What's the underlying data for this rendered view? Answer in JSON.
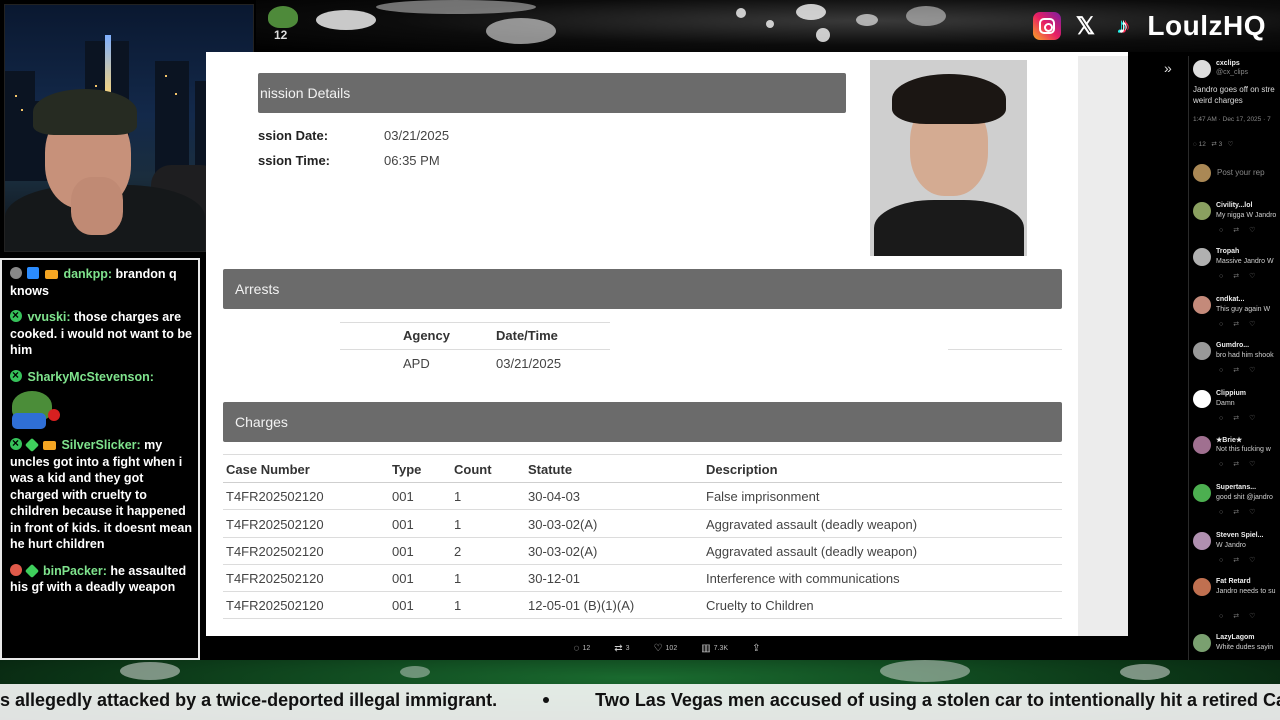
{
  "overlay": {
    "brand": "LoulzHQ",
    "pepe_badge": "12",
    "social_icons": [
      "instagram-icon",
      "x-icon",
      "tiktok-icon"
    ]
  },
  "chat": {
    "messages": [
      {
        "user": "dankpp:",
        "text": " brandon q knows"
      },
      {
        "user": "vvuski:",
        "text": " those charges are cooked. i would not want to be him"
      },
      {
        "user": "SharkyMcStevenson:",
        "text": ""
      },
      {
        "user": "SilverSlicker:",
        "text": " my uncles got into a fight when i was a kid and they got charged with cruelty to children because it happened in front of kids. it doesnt mean he hurt children"
      },
      {
        "user": "binPacker:",
        "text": " he assaulted his gf with a deadly weapon"
      }
    ]
  },
  "record": {
    "admission_title": "nission Details",
    "admission_date_label": "ssion Date:",
    "admission_date": "03/21/2025",
    "admission_time_label": "ssion Time:",
    "admission_time": "06:35 PM",
    "arrests_title": "Arrests",
    "arrests_headers": [
      "Agency",
      "Date/Time"
    ],
    "arrests_rows": [
      [
        "APD",
        "03/21/2025"
      ]
    ],
    "charges_title": "Charges",
    "charges_headers": [
      "Case Number",
      "Type",
      "Count",
      "Statute",
      "Description"
    ],
    "charges_rows": [
      [
        "T4FR202502120",
        "001",
        "1",
        "30-04-03",
        "False imprisonment"
      ],
      [
        "T4FR202502120",
        "001",
        "1",
        "30-03-02(A)",
        "Aggravated assault (deadly weapon)"
      ],
      [
        "T4FR202502120",
        "001",
        "2",
        "30-03-02(A)",
        "Aggravated assault (deadly weapon)"
      ],
      [
        "T4FR202502120",
        "001",
        "1",
        "30-12-01",
        "Interference with communications"
      ],
      [
        "T4FR202502120",
        "001",
        "1",
        "12-05-01 (B)(1)(A)",
        "Cruelty to Children"
      ]
    ]
  },
  "twitter": {
    "author": "cxclips",
    "handle": "@cx_clips",
    "post_text": "Jandro goes off on stre weird charges",
    "post_meta": "1:47 AM · Dec 17, 2025 · 7",
    "post_stats": "12   3   ",
    "reply_placeholder": "Post your rep",
    "replies": [
      {
        "name": "Civility...lol",
        "text": "My nigga W Jandro",
        "color": "#8aa060"
      },
      {
        "name": "Tropah",
        "text": "Massive Jandro W",
        "color": "#b0b0b0"
      },
      {
        "name": "cndkat...",
        "text": "This guy again W",
        "color": "#c48a7a"
      },
      {
        "name": "Gumdro...",
        "text": "bro had him shook",
        "color": "#999999"
      },
      {
        "name": "Clippium",
        "text": "Damn",
        "color": "#ffffff"
      },
      {
        "name": "★Brie★",
        "text": "Not this fucking w",
        "color": "#a07090"
      },
      {
        "name": "Supertans...",
        "text": "good shit @jandro",
        "color": "#4caf50"
      },
      {
        "name": "Steven Spiel...",
        "text": "W Jandro",
        "color": "#b090b0"
      },
      {
        "name": "Fat Retard",
        "text": "Jandro needs to su",
        "color": "#c07050"
      },
      {
        "name": "LazyLagom",
        "text": "White dudes sayin",
        "color": "#7aa070"
      }
    ]
  },
  "video_bar": {
    "replies": "12",
    "reposts": "3",
    "likes": "102",
    "views": "7.3K"
  },
  "ticker": {
    "item1": "s allegedly attacked by a twice-deported illegal immigrant.",
    "item2": "Two Las Vegas men accused of using a stolen car to intentionally hit a retired Californ"
  }
}
